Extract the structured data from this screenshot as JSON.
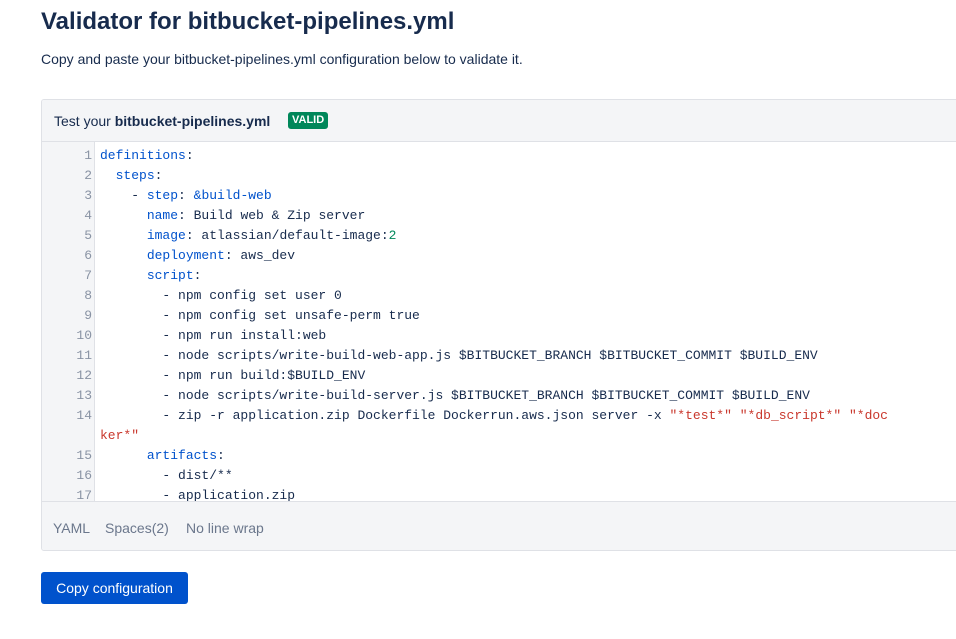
{
  "page": {
    "title": "Validator for bitbucket-pipelines.yml",
    "subtitle": "Copy and paste your bitbucket-pipelines.yml configuration below to validate it."
  },
  "panel": {
    "label_prefix": "Test your ",
    "label_file": "bitbucket-pipelines.yml",
    "status_badge": "VALID",
    "colors": {
      "badge": "#00875a",
      "keyword": "#0052cc",
      "string": "#c9372c",
      "number": "#00875a"
    }
  },
  "editor": {
    "lines": [
      {
        "n": "1",
        "segs": [
          [
            "k",
            "definitions"
          ],
          [
            "p",
            ":"
          ]
        ]
      },
      {
        "n": "2",
        "segs": [
          [
            "p",
            "  "
          ],
          [
            "k",
            "steps"
          ],
          [
            "p",
            ":"
          ]
        ]
      },
      {
        "n": "3",
        "segs": [
          [
            "p",
            "    - "
          ],
          [
            "k",
            "step"
          ],
          [
            "p",
            ": "
          ],
          [
            "a",
            "&build-web"
          ]
        ]
      },
      {
        "n": "4",
        "segs": [
          [
            "p",
            "      "
          ],
          [
            "k",
            "name"
          ],
          [
            "p",
            ": Build web & Zip server"
          ]
        ]
      },
      {
        "n": "5",
        "segs": [
          [
            "p",
            "      "
          ],
          [
            "k",
            "image"
          ],
          [
            "p",
            ": atlassian/default-image:"
          ],
          [
            "num",
            "2"
          ]
        ]
      },
      {
        "n": "6",
        "segs": [
          [
            "p",
            "      "
          ],
          [
            "k",
            "deployment"
          ],
          [
            "p",
            ": aws_dev"
          ]
        ]
      },
      {
        "n": "7",
        "segs": [
          [
            "p",
            "      "
          ],
          [
            "k",
            "script"
          ],
          [
            "p",
            ":"
          ]
        ]
      },
      {
        "n": "8",
        "segs": [
          [
            "p",
            "        - npm config set user 0"
          ]
        ]
      },
      {
        "n": "9",
        "segs": [
          [
            "p",
            "        - npm config set unsafe-perm true"
          ]
        ]
      },
      {
        "n": "10",
        "segs": [
          [
            "p",
            "        - npm run install:web"
          ]
        ]
      },
      {
        "n": "11",
        "segs": [
          [
            "p",
            "        - node scripts/write-build-web-app.js $BITBUCKET_BRANCH $BITBUCKET_COMMIT $BUILD_ENV"
          ]
        ]
      },
      {
        "n": "12",
        "segs": [
          [
            "p",
            "        - npm run build:$BUILD_ENV"
          ]
        ]
      },
      {
        "n": "13",
        "segs": [
          [
            "p",
            "        - node scripts/write-build-server.js $BITBUCKET_BRANCH $BITBUCKET_COMMIT $BUILD_ENV"
          ]
        ]
      },
      {
        "n": "14",
        "segs": [
          [
            "p",
            "        - zip -r application.zip Dockerfile Dockerrun.aws.json server -x "
          ],
          [
            "s",
            "\"*test*\""
          ],
          [
            "p",
            " "
          ],
          [
            "s",
            "\"*db_script*\""
          ],
          [
            "p",
            " "
          ],
          [
            "s",
            "\"*doc"
          ]
        ]
      },
      {
        "n": "",
        "segs": [
          [
            "s",
            "ker*\""
          ]
        ]
      },
      {
        "n": "15",
        "segs": [
          [
            "p",
            "      "
          ],
          [
            "k",
            "artifacts"
          ],
          [
            "p",
            ":"
          ]
        ]
      },
      {
        "n": "16",
        "segs": [
          [
            "p",
            "        - dist/**"
          ]
        ]
      },
      {
        "n": "17",
        "segs": [
          [
            "p",
            "        - application.zip"
          ]
        ]
      }
    ]
  },
  "footer": {
    "language": "YAML",
    "indent": "Spaces(2)",
    "wrap": "No line wrap"
  },
  "actions": {
    "copy_label": "Copy configuration"
  }
}
